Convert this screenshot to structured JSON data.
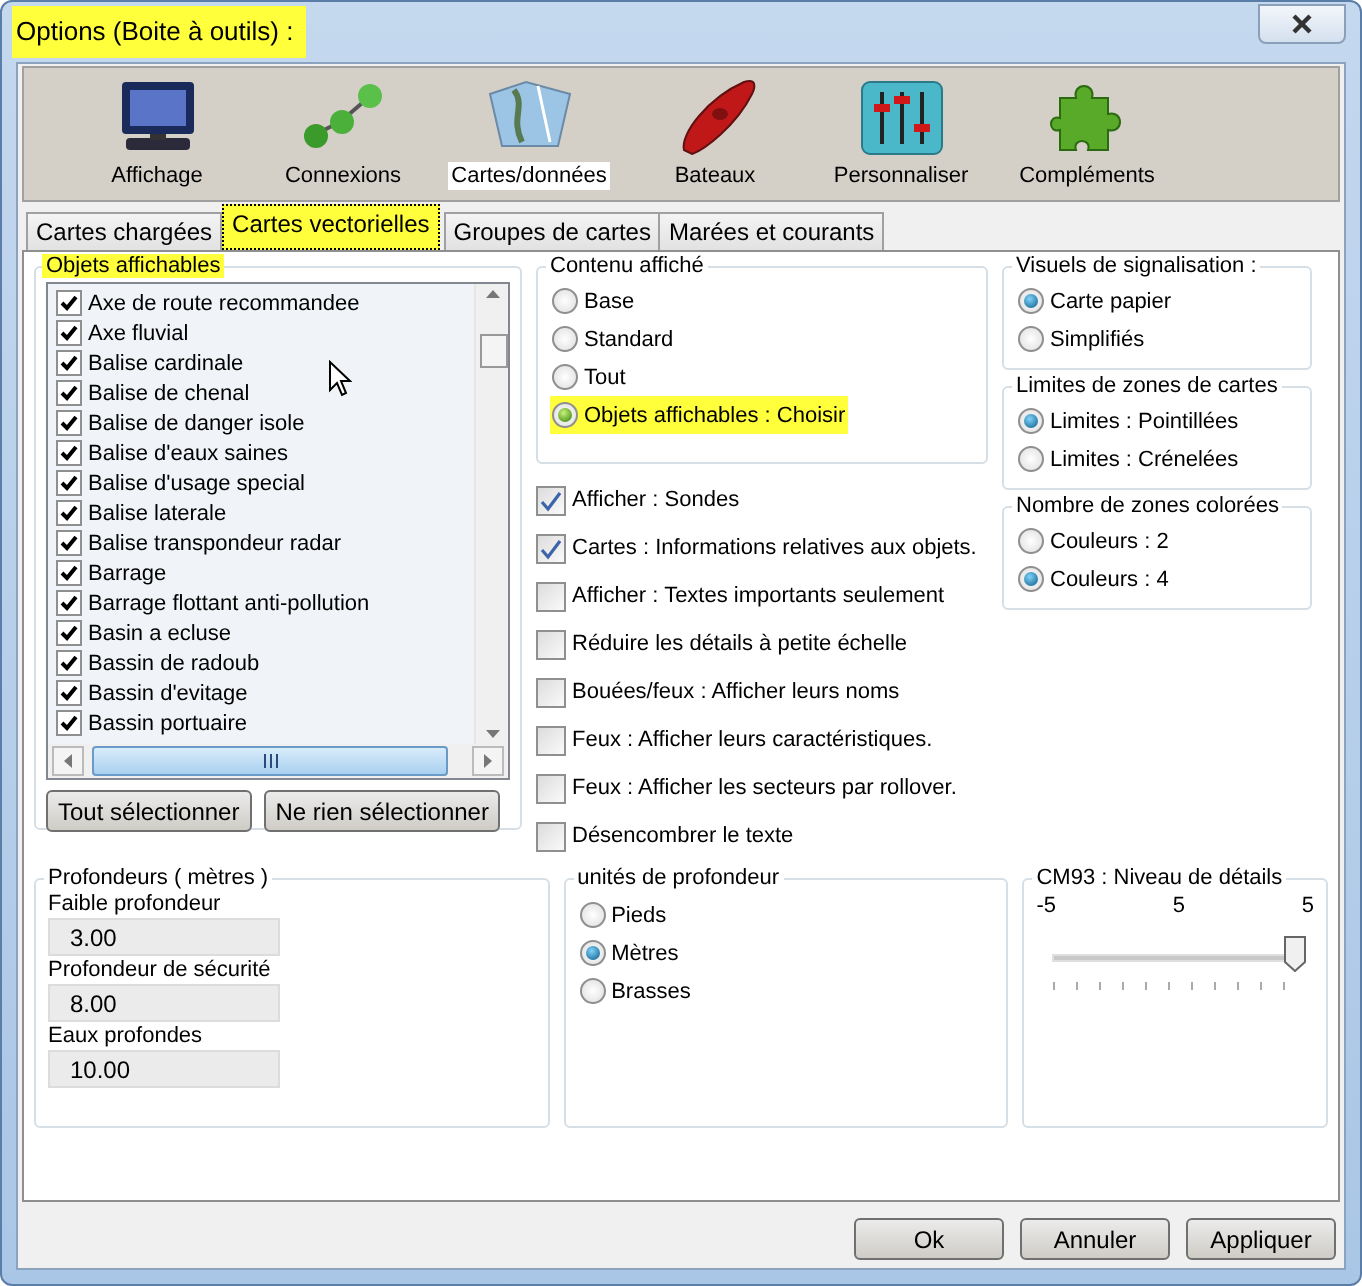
{
  "window": {
    "title": "Options (Boite à outils) :",
    "title_highlighted": true
  },
  "toolbar": [
    {
      "label": "Affichage",
      "selected": false
    },
    {
      "label": "Connexions",
      "selected": false
    },
    {
      "label": "Cartes/données",
      "selected": true
    },
    {
      "label": "Bateaux",
      "selected": false
    },
    {
      "label": "Personnaliser",
      "selected": false
    },
    {
      "label": "Compléments",
      "selected": false
    }
  ],
  "tabs": [
    {
      "label": "Cartes chargées",
      "selected": false,
      "highlighted": false
    },
    {
      "label": "Cartes vectorielles",
      "selected": true,
      "highlighted": true
    },
    {
      "label": "Groupes de cartes",
      "selected": false,
      "highlighted": false
    },
    {
      "label": "Marées et courants",
      "selected": false,
      "highlighted": false
    }
  ],
  "objects_group": {
    "title": "Objets affichables",
    "highlighted": true,
    "items": [
      {
        "label": "Axe de route recommandee",
        "checked": true
      },
      {
        "label": "Axe fluvial",
        "checked": true
      },
      {
        "label": "Balise cardinale",
        "checked": true
      },
      {
        "label": "Balise de chenal",
        "checked": true
      },
      {
        "label": "Balise de danger isole",
        "checked": true
      },
      {
        "label": "Balise d'eaux saines",
        "checked": true
      },
      {
        "label": "Balise d'usage special",
        "checked": true
      },
      {
        "label": "Balise laterale",
        "checked": true
      },
      {
        "label": "Balise transpondeur radar",
        "checked": true
      },
      {
        "label": "Barrage",
        "checked": true
      },
      {
        "label": "Barrage flottant anti-pollution",
        "checked": true
      },
      {
        "label": "Basin a ecluse",
        "checked": true
      },
      {
        "label": "Bassin de radoub",
        "checked": true
      },
      {
        "label": "Bassin d'evitage",
        "checked": true
      },
      {
        "label": "Bassin portuaire",
        "checked": true
      }
    ],
    "buttons": [
      "Tout sélectionner",
      "Ne rien sélectionner"
    ]
  },
  "display_content": {
    "title": "Contenu affiché",
    "options": [
      {
        "label": "Base",
        "selected": false,
        "highlighted": false
      },
      {
        "label": "Standard",
        "selected": false,
        "highlighted": false
      },
      {
        "label": "Tout",
        "selected": false,
        "highlighted": false
      },
      {
        "label": "Objets affichables : Choisir",
        "selected": true,
        "highlighted": true
      }
    ]
  },
  "display_options": [
    {
      "label": "Afficher : Sondes",
      "checked": true
    },
    {
      "label": "Cartes : Informations relatives aux objets.",
      "checked": true
    },
    {
      "label": "Afficher : Textes importants seulement",
      "checked": false
    },
    {
      "label": "Réduire les détails à petite échelle",
      "checked": false
    },
    {
      "label": "Bouées/feux : Afficher leurs noms",
      "checked": false
    },
    {
      "label": "Feux : Afficher leurs caractéristiques.",
      "checked": false
    },
    {
      "label": "Feux : Afficher les secteurs par rollover.",
      "checked": false
    },
    {
      "label": "Désencombrer le texte",
      "checked": false
    }
  ],
  "signal_visuals": {
    "title": "Visuels de signalisation :",
    "options": [
      {
        "label": "Carte papier",
        "selected": true
      },
      {
        "label": "Simplifiés",
        "selected": false
      }
    ]
  },
  "chart_boundaries": {
    "title": "Limites de zones de cartes",
    "options": [
      {
        "label": "Limites : Pointillées",
        "selected": true
      },
      {
        "label": "Limites : Crénelées",
        "selected": false
      }
    ]
  },
  "color_zones": {
    "title": "Nombre de zones colorées",
    "options": [
      {
        "label": "Couleurs : 2",
        "selected": false
      },
      {
        "label": "Couleurs : 4",
        "selected": true
      }
    ]
  },
  "depths": {
    "title": "Profondeurs ( mètres )",
    "fields": [
      {
        "label": "Faible profondeur",
        "value": "3.00"
      },
      {
        "label": "Profondeur de sécurité",
        "value": "8.00"
      },
      {
        "label": "Eaux profondes",
        "value": "10.00"
      }
    ]
  },
  "depth_units": {
    "title": "unités de profondeur",
    "options": [
      {
        "label": "Pieds",
        "selected": false
      },
      {
        "label": "Mètres",
        "selected": true
      },
      {
        "label": "Brasses",
        "selected": false
      }
    ]
  },
  "detail_level": {
    "title": "CM93 : Niveau de détails",
    "scale_labels": [
      "-5",
      "5",
      "5"
    ],
    "level": 1
  },
  "buttons": [
    "Ok",
    "Annuler",
    "Appliquer"
  ]
}
